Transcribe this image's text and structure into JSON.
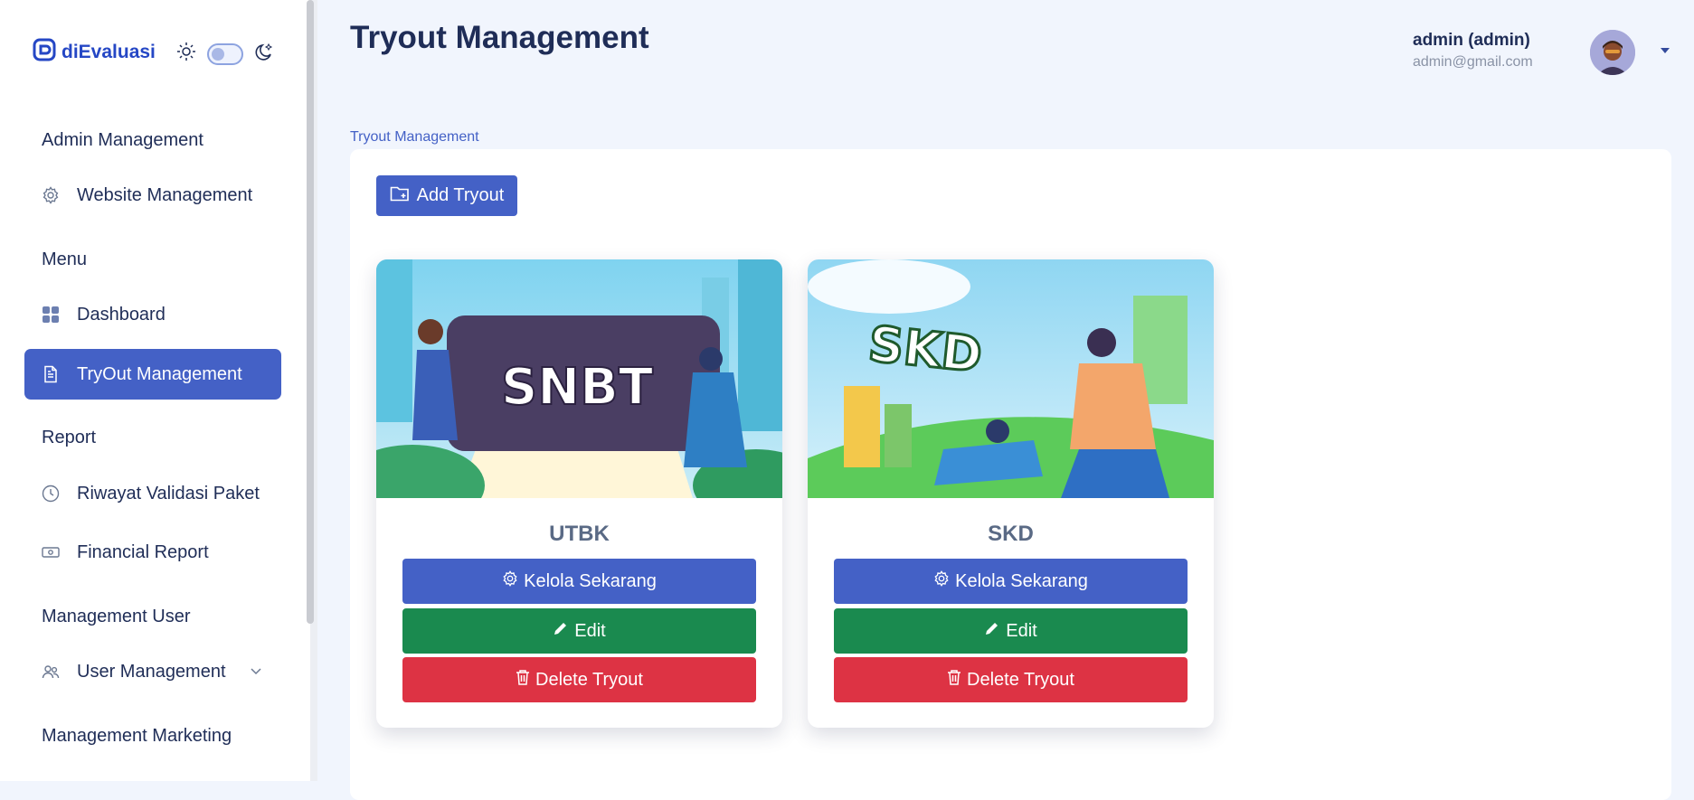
{
  "app": {
    "logo_text": "diEvaluasi"
  },
  "sidebar": {
    "sections": [
      {
        "title": "Admin Management"
      },
      {
        "title": "Menu"
      },
      {
        "title": "Report"
      },
      {
        "title": "Management User"
      },
      {
        "title": "Management Marketing"
      }
    ],
    "items": [
      {
        "label": "Website Management",
        "icon": "gear-icon"
      },
      {
        "label": "Dashboard",
        "icon": "grid-icon"
      },
      {
        "label": "TryOut Management",
        "icon": "document-icon",
        "active": true
      },
      {
        "label": "Riwayat Validasi Paket",
        "icon": "clock-icon"
      },
      {
        "label": "Financial Report",
        "icon": "cash-icon"
      },
      {
        "label": "User Management",
        "icon": "users-icon",
        "expandable": true
      }
    ]
  },
  "header": {
    "title": "Tryout Management",
    "user_name": "admin (admin)",
    "user_email": "admin@gmail.com"
  },
  "breadcrumb": "Tryout Management",
  "actions": {
    "add_label": "Add Tryout"
  },
  "cards": [
    {
      "image_text": "SNBT",
      "title": "UTBK",
      "manage_label": "Kelola Sekarang",
      "edit_label": "Edit",
      "delete_label": "Delete Tryout"
    },
    {
      "image_text": "SKD",
      "title": "SKD",
      "manage_label": "Kelola Sekarang",
      "edit_label": "Edit",
      "delete_label": "Delete Tryout"
    }
  ],
  "colors": {
    "primary": "#4461c6",
    "success": "#1a8a4f",
    "danger": "#dd3344",
    "text": "#1f2d57"
  }
}
